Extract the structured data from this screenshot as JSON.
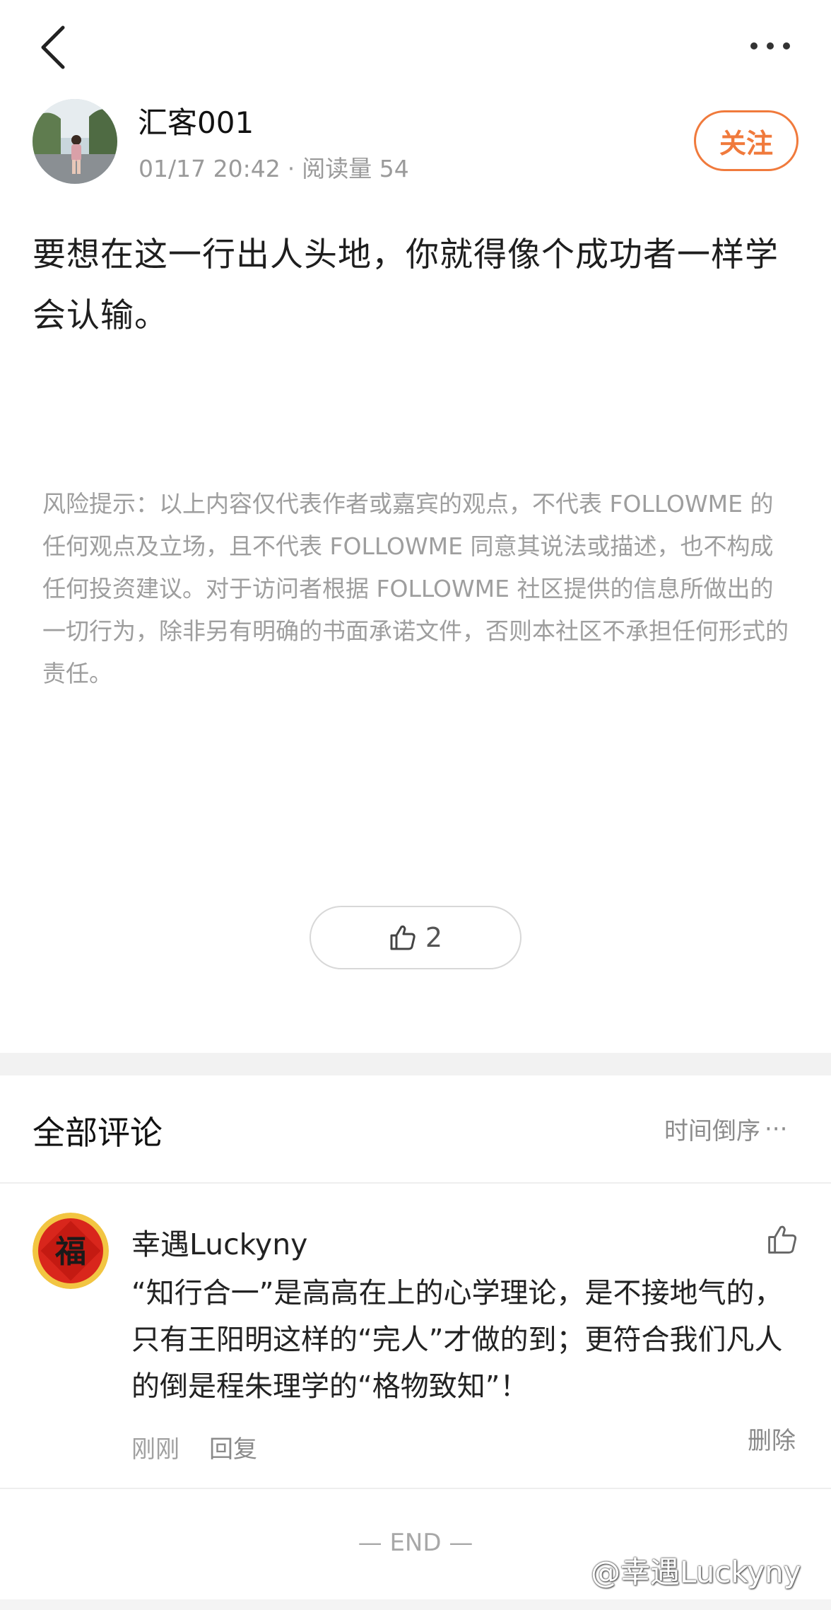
{
  "nav": {
    "back_icon": "chevron-left-icon",
    "more_icon": "more-horizontal-icon"
  },
  "author": {
    "name": "汇客001",
    "date": "01/17 20:42",
    "separator": "·",
    "read_count": "阅读量 54",
    "follow_label": "关注",
    "accent_color": "#f07a3c"
  },
  "post": {
    "content": "要想在这一行出人头地，你就得像个成功者一样学会认输。",
    "risk_notice": "风险提示：以上内容仅代表作者或嘉宾的观点，不代表 FOLLOWME 的任何观点及立场，且不代表 FOLLOWME 同意其说法或描述，也不构成任何投资建议。对于访问者根据 FOLLOWME 社区提供的信息所做出的一切行为，除非另有明确的书面承诺文件，否则本社区不承担任何形式的责任。"
  },
  "like": {
    "icon": "thumbs-up-icon",
    "count": "2"
  },
  "comments": {
    "title": "全部评论",
    "sort_label": "时间倒序",
    "sort_more": "···",
    "items": [
      {
        "user": "幸遇Luckyny",
        "avatar_text": "福",
        "text": "“知行合一”是高高在上的心学理论，是不接地气的，只有王阳明这样的“完人”才做的到；更符合我们凡人的倒是程朱理学的“格物致知”！",
        "time": "刚刚",
        "reply_label": "回复",
        "delete_label": "删除"
      }
    ]
  },
  "end_label": "— END —",
  "watermark": "@幸遇Luckyny"
}
